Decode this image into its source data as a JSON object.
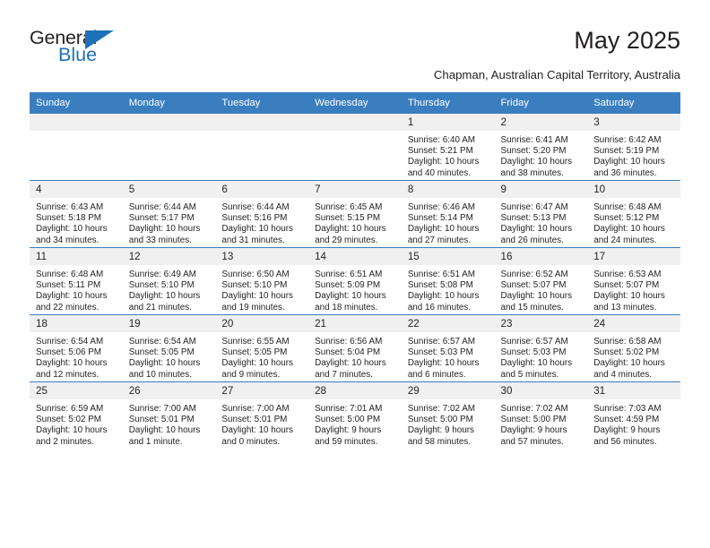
{
  "brand": {
    "name_dark": "General",
    "name_blue": "Blue",
    "accent_color": "#1c72b8"
  },
  "header": {
    "title": "May 2025",
    "subtitle": "Chapman, Australian Capital Territory, Australia",
    "header_bg": "#3a7ebf",
    "daynum_bg": "#f0f0f0"
  },
  "weekdays": [
    "Sunday",
    "Monday",
    "Tuesday",
    "Wednesday",
    "Thursday",
    "Friday",
    "Saturday"
  ],
  "weeks": [
    [
      {
        "day": "",
        "sunrise": "",
        "sunset": "",
        "daylight1": "",
        "daylight2": ""
      },
      {
        "day": "",
        "sunrise": "",
        "sunset": "",
        "daylight1": "",
        "daylight2": ""
      },
      {
        "day": "",
        "sunrise": "",
        "sunset": "",
        "daylight1": "",
        "daylight2": ""
      },
      {
        "day": "",
        "sunrise": "",
        "sunset": "",
        "daylight1": "",
        "daylight2": ""
      },
      {
        "day": "1",
        "sunrise": "Sunrise: 6:40 AM",
        "sunset": "Sunset: 5:21 PM",
        "daylight1": "Daylight: 10 hours",
        "daylight2": "and 40 minutes."
      },
      {
        "day": "2",
        "sunrise": "Sunrise: 6:41 AM",
        "sunset": "Sunset: 5:20 PM",
        "daylight1": "Daylight: 10 hours",
        "daylight2": "and 38 minutes."
      },
      {
        "day": "3",
        "sunrise": "Sunrise: 6:42 AM",
        "sunset": "Sunset: 5:19 PM",
        "daylight1": "Daylight: 10 hours",
        "daylight2": "and 36 minutes."
      }
    ],
    [
      {
        "day": "4",
        "sunrise": "Sunrise: 6:43 AM",
        "sunset": "Sunset: 5:18 PM",
        "daylight1": "Daylight: 10 hours",
        "daylight2": "and 34 minutes."
      },
      {
        "day": "5",
        "sunrise": "Sunrise: 6:44 AM",
        "sunset": "Sunset: 5:17 PM",
        "daylight1": "Daylight: 10 hours",
        "daylight2": "and 33 minutes."
      },
      {
        "day": "6",
        "sunrise": "Sunrise: 6:44 AM",
        "sunset": "Sunset: 5:16 PM",
        "daylight1": "Daylight: 10 hours",
        "daylight2": "and 31 minutes."
      },
      {
        "day": "7",
        "sunrise": "Sunrise: 6:45 AM",
        "sunset": "Sunset: 5:15 PM",
        "daylight1": "Daylight: 10 hours",
        "daylight2": "and 29 minutes."
      },
      {
        "day": "8",
        "sunrise": "Sunrise: 6:46 AM",
        "sunset": "Sunset: 5:14 PM",
        "daylight1": "Daylight: 10 hours",
        "daylight2": "and 27 minutes."
      },
      {
        "day": "9",
        "sunrise": "Sunrise: 6:47 AM",
        "sunset": "Sunset: 5:13 PM",
        "daylight1": "Daylight: 10 hours",
        "daylight2": "and 26 minutes."
      },
      {
        "day": "10",
        "sunrise": "Sunrise: 6:48 AM",
        "sunset": "Sunset: 5:12 PM",
        "daylight1": "Daylight: 10 hours",
        "daylight2": "and 24 minutes."
      }
    ],
    [
      {
        "day": "11",
        "sunrise": "Sunrise: 6:48 AM",
        "sunset": "Sunset: 5:11 PM",
        "daylight1": "Daylight: 10 hours",
        "daylight2": "and 22 minutes."
      },
      {
        "day": "12",
        "sunrise": "Sunrise: 6:49 AM",
        "sunset": "Sunset: 5:10 PM",
        "daylight1": "Daylight: 10 hours",
        "daylight2": "and 21 minutes."
      },
      {
        "day": "13",
        "sunrise": "Sunrise: 6:50 AM",
        "sunset": "Sunset: 5:10 PM",
        "daylight1": "Daylight: 10 hours",
        "daylight2": "and 19 minutes."
      },
      {
        "day": "14",
        "sunrise": "Sunrise: 6:51 AM",
        "sunset": "Sunset: 5:09 PM",
        "daylight1": "Daylight: 10 hours",
        "daylight2": "and 18 minutes."
      },
      {
        "day": "15",
        "sunrise": "Sunrise: 6:51 AM",
        "sunset": "Sunset: 5:08 PM",
        "daylight1": "Daylight: 10 hours",
        "daylight2": "and 16 minutes."
      },
      {
        "day": "16",
        "sunrise": "Sunrise: 6:52 AM",
        "sunset": "Sunset: 5:07 PM",
        "daylight1": "Daylight: 10 hours",
        "daylight2": "and 15 minutes."
      },
      {
        "day": "17",
        "sunrise": "Sunrise: 6:53 AM",
        "sunset": "Sunset: 5:07 PM",
        "daylight1": "Daylight: 10 hours",
        "daylight2": "and 13 minutes."
      }
    ],
    [
      {
        "day": "18",
        "sunrise": "Sunrise: 6:54 AM",
        "sunset": "Sunset: 5:06 PM",
        "daylight1": "Daylight: 10 hours",
        "daylight2": "and 12 minutes."
      },
      {
        "day": "19",
        "sunrise": "Sunrise: 6:54 AM",
        "sunset": "Sunset: 5:05 PM",
        "daylight1": "Daylight: 10 hours",
        "daylight2": "and 10 minutes."
      },
      {
        "day": "20",
        "sunrise": "Sunrise: 6:55 AM",
        "sunset": "Sunset: 5:05 PM",
        "daylight1": "Daylight: 10 hours",
        "daylight2": "and 9 minutes."
      },
      {
        "day": "21",
        "sunrise": "Sunrise: 6:56 AM",
        "sunset": "Sunset: 5:04 PM",
        "daylight1": "Daylight: 10 hours",
        "daylight2": "and 7 minutes."
      },
      {
        "day": "22",
        "sunrise": "Sunrise: 6:57 AM",
        "sunset": "Sunset: 5:03 PM",
        "daylight1": "Daylight: 10 hours",
        "daylight2": "and 6 minutes."
      },
      {
        "day": "23",
        "sunrise": "Sunrise: 6:57 AM",
        "sunset": "Sunset: 5:03 PM",
        "daylight1": "Daylight: 10 hours",
        "daylight2": "and 5 minutes."
      },
      {
        "day": "24",
        "sunrise": "Sunrise: 6:58 AM",
        "sunset": "Sunset: 5:02 PM",
        "daylight1": "Daylight: 10 hours",
        "daylight2": "and 4 minutes."
      }
    ],
    [
      {
        "day": "25",
        "sunrise": "Sunrise: 6:59 AM",
        "sunset": "Sunset: 5:02 PM",
        "daylight1": "Daylight: 10 hours",
        "daylight2": "and 2 minutes."
      },
      {
        "day": "26",
        "sunrise": "Sunrise: 7:00 AM",
        "sunset": "Sunset: 5:01 PM",
        "daylight1": "Daylight: 10 hours",
        "daylight2": "and 1 minute."
      },
      {
        "day": "27",
        "sunrise": "Sunrise: 7:00 AM",
        "sunset": "Sunset: 5:01 PM",
        "daylight1": "Daylight: 10 hours",
        "daylight2": "and 0 minutes."
      },
      {
        "day": "28",
        "sunrise": "Sunrise: 7:01 AM",
        "sunset": "Sunset: 5:00 PM",
        "daylight1": "Daylight: 9 hours",
        "daylight2": "and 59 minutes."
      },
      {
        "day": "29",
        "sunrise": "Sunrise: 7:02 AM",
        "sunset": "Sunset: 5:00 PM",
        "daylight1": "Daylight: 9 hours",
        "daylight2": "and 58 minutes."
      },
      {
        "day": "30",
        "sunrise": "Sunrise: 7:02 AM",
        "sunset": "Sunset: 5:00 PM",
        "daylight1": "Daylight: 9 hours",
        "daylight2": "and 57 minutes."
      },
      {
        "day": "31",
        "sunrise": "Sunrise: 7:03 AM",
        "sunset": "Sunset: 4:59 PM",
        "daylight1": "Daylight: 9 hours",
        "daylight2": "and 56 minutes."
      }
    ]
  ]
}
